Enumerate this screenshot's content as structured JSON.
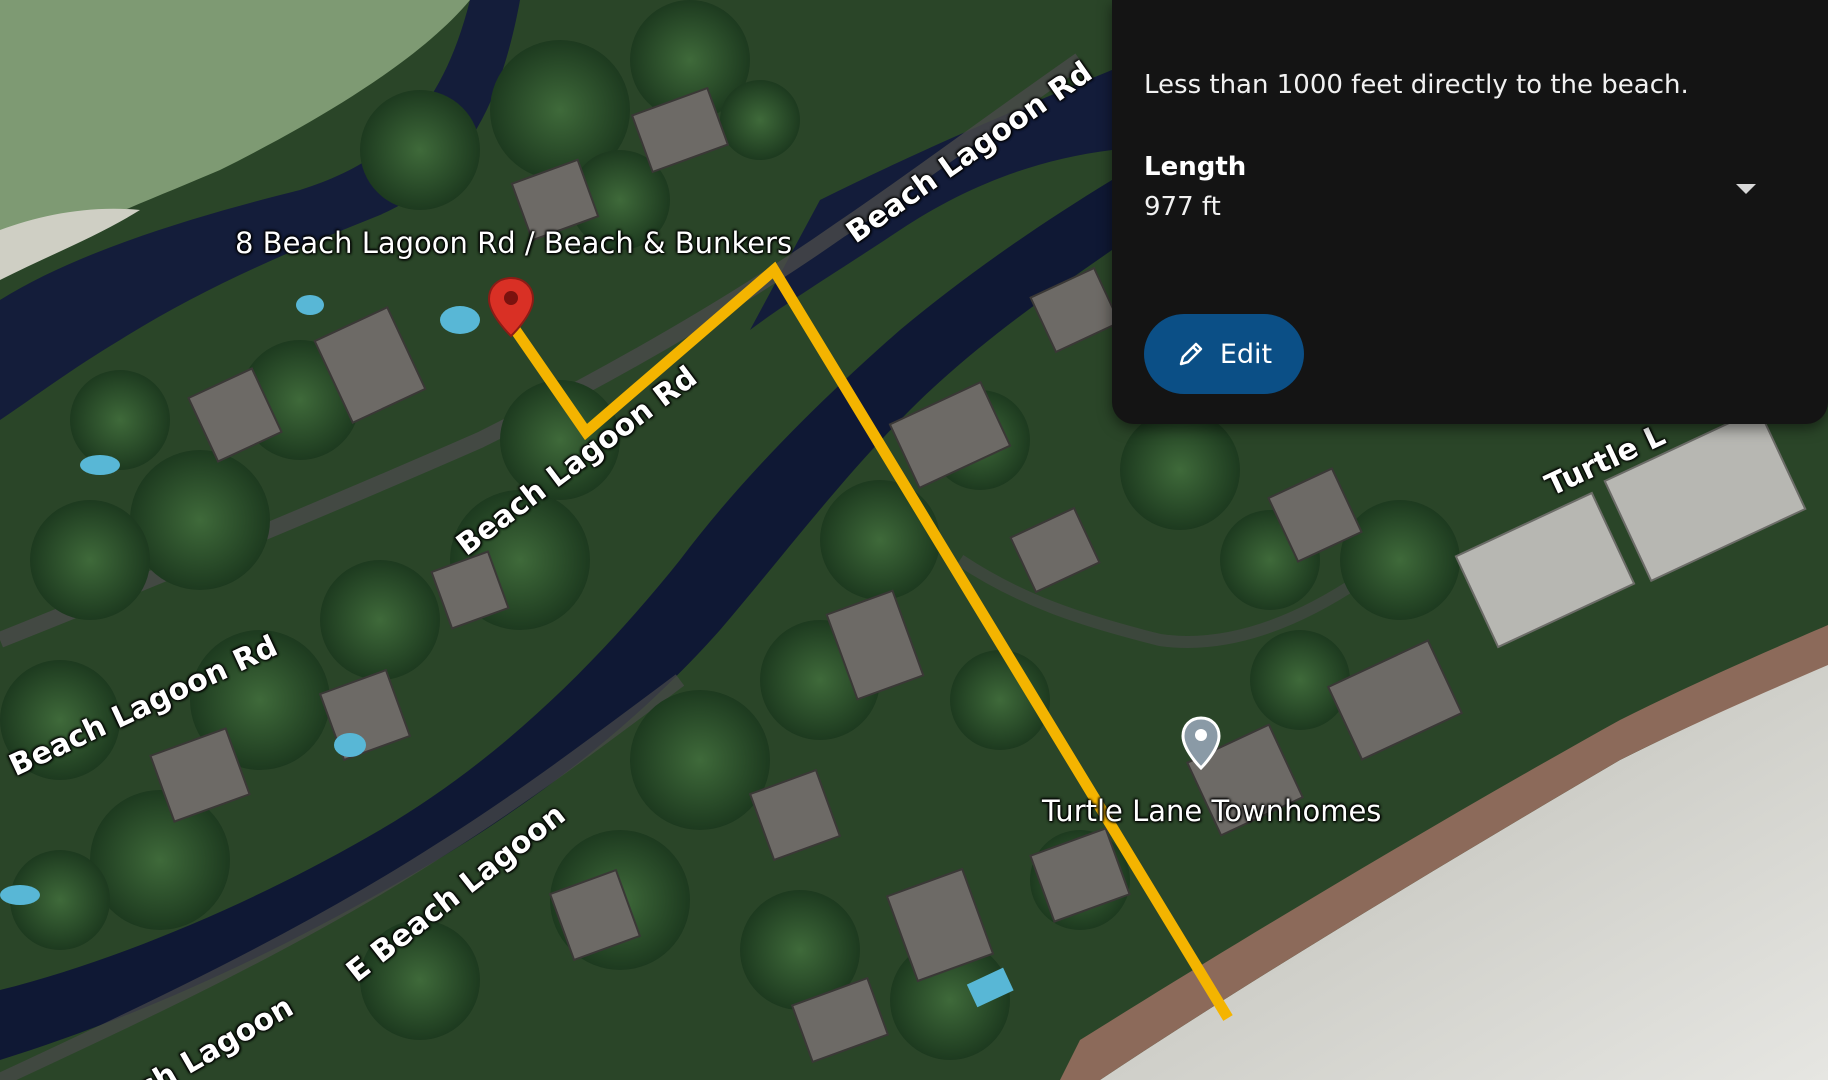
{
  "map": {
    "place_label": "8 Beach Lagoon Rd / Beach & Bunkers",
    "poi_label": "Turtle Lane Townhomes",
    "roads": [
      "Beach Lagoon Rd",
      "Beach Lagoon Rd",
      "Beach Lagoon Rd",
      "E Beach Lagoon",
      "ch Lagoon",
      "Turtle L"
    ],
    "route_color": "#f4b400",
    "pin_color": "#d93025"
  },
  "panel": {
    "description": "Less than 1000 feet directly to the beach.",
    "length_title": "Length",
    "length_value": "977 ft",
    "edit_label": "Edit"
  }
}
